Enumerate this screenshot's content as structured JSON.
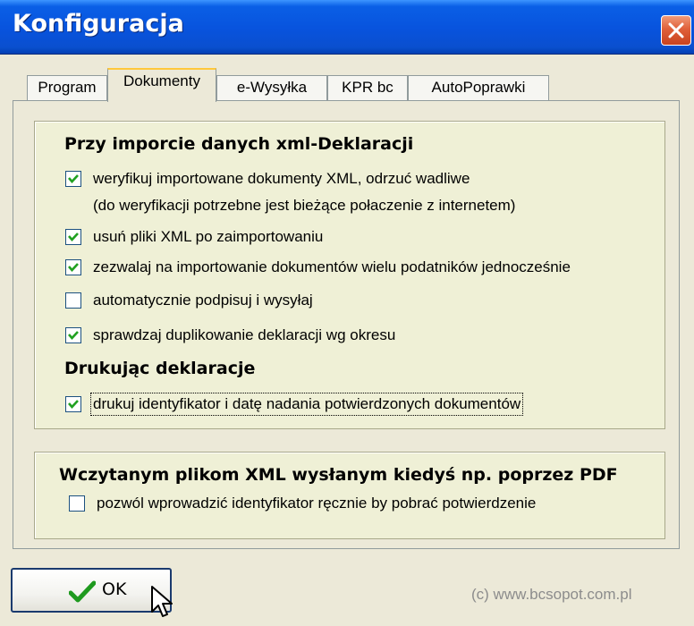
{
  "window": {
    "title": "Konfiguracja"
  },
  "tabs": [
    {
      "label": "Program"
    },
    {
      "label": "Dokumenty"
    },
    {
      "label": "e-Wysyłka"
    },
    {
      "label": "KPR bc"
    },
    {
      "label": "AutoPoprawki"
    }
  ],
  "active_tab": "Dokumenty",
  "group1": {
    "import_heading": "Przy imporcie danych xml-Deklaracji",
    "options": [
      {
        "label": "weryfikuj importowane dokumenty XML, odrzuć wadliwe",
        "label2": "(do weryfikacji potrzebne jest bieżące połaczenie z internetem)",
        "checked": true
      },
      {
        "label": "usuń pliki XML po zaimportowaniu",
        "checked": true
      },
      {
        "label": "zezwalaj na importowanie dokumentów wielu podatników jednocześnie",
        "checked": true
      },
      {
        "label": "automatycznie podpisuj i wysyłaj",
        "checked": false
      },
      {
        "label": "sprawdzaj duplikowanie deklaracji wg okresu",
        "checked": true
      }
    ],
    "print_heading": "Drukując deklaracje",
    "print_option": {
      "label": "drukuj identyfikator i datę nadania potwierdzonych dokumentów",
      "checked": true
    }
  },
  "group2": {
    "heading": "Wczytanym plikom XML wysłanym kiedyś np. poprzez PDF",
    "option": {
      "label": "pozwól wprowadzić identyfikator ręcznie by pobrać potwierdzenie",
      "checked": false
    }
  },
  "ok_button": {
    "label": "OK"
  },
  "copyright": "(c) www.bcsopot.com.pl",
  "icons": {
    "close": "close-icon",
    "check": "checkmark-icon",
    "ok": "green-checkmark-icon",
    "cursor": "mouse-pointer-icon"
  },
  "colors": {
    "titlebar": "#0853dd",
    "close_button": "#e0603a",
    "panel": "#eff0d6",
    "window": "#ece9d8",
    "active_tab_accent": "#ffc83c",
    "checkbox_border": "#1c5180",
    "copyright": "#8c8c8c"
  }
}
